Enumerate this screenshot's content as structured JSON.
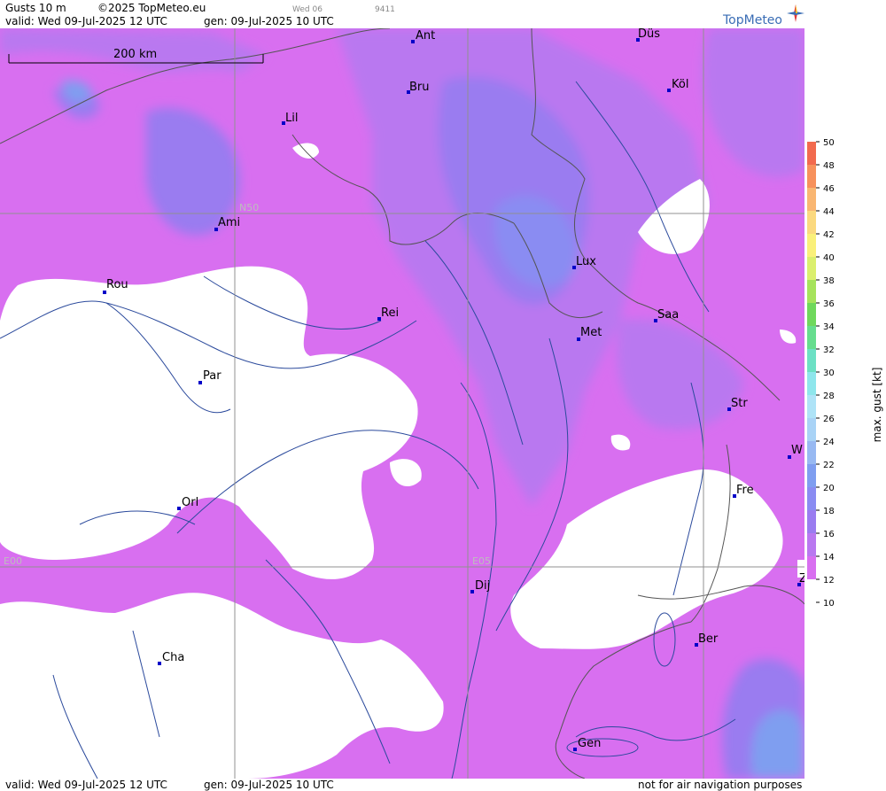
{
  "header": {
    "title": "Gusts 10 m",
    "copyright": "©2025 TopMeteo.eu",
    "day_mark": "Wed 06",
    "code": "9411",
    "valid": "valid:  Wed  09-Jul-2025  12 UTC",
    "generated": "gen: 09-Jul-2025 10 UTC"
  },
  "brand": {
    "name": "TopMeteo",
    "color": "#3a6db5"
  },
  "scale_bar": {
    "label": "200 km"
  },
  "grid_labels": [
    "N50",
    "E00",
    "E05"
  ],
  "cities": [
    {
      "name": "Ant"
    },
    {
      "name": "Düs"
    },
    {
      "name": "Bru"
    },
    {
      "name": "Köl"
    },
    {
      "name": "Lil"
    },
    {
      "name": "Ami"
    },
    {
      "name": "Lux"
    },
    {
      "name": "Rou"
    },
    {
      "name": "Rei"
    },
    {
      "name": "Saa"
    },
    {
      "name": "Met"
    },
    {
      "name": "Par"
    },
    {
      "name": "Str"
    },
    {
      "name": "W"
    },
    {
      "name": "Fre"
    },
    {
      "name": "Orl"
    },
    {
      "name": "Dij"
    },
    {
      "name": "Z"
    },
    {
      "name": "Ber"
    },
    {
      "name": "Cha"
    },
    {
      "name": "Gen"
    }
  ],
  "legend": {
    "label": "max. gust [kt]",
    "ticks": [
      "50",
      "48",
      "46",
      "44",
      "42",
      "40",
      "38",
      "36",
      "34",
      "32",
      "30",
      "28",
      "26",
      "24",
      "22",
      "20",
      "18",
      "16",
      "14",
      "12",
      "10"
    ],
    "colors": [
      "#f26a4e",
      "#f7915c",
      "#f9b672",
      "#fbd97f",
      "#faf07a",
      "#dbef6e",
      "#a6e35c",
      "#6fd85c",
      "#66dd8e",
      "#6ce0c4",
      "#8ee6ec",
      "#aee3f7",
      "#a9d3f6",
      "#98b9f2",
      "#7f9ef0",
      "#8a8cf2",
      "#9a7cf0",
      "#b978f0",
      "#d86ff0",
      "#ffffff"
    ]
  },
  "footer": {
    "valid": "valid:  Wed  09-Jul-2025  12 UTC",
    "generated": "gen: 09-Jul-2025 10 UTC",
    "disclaimer": "not for air navigation purposes"
  }
}
